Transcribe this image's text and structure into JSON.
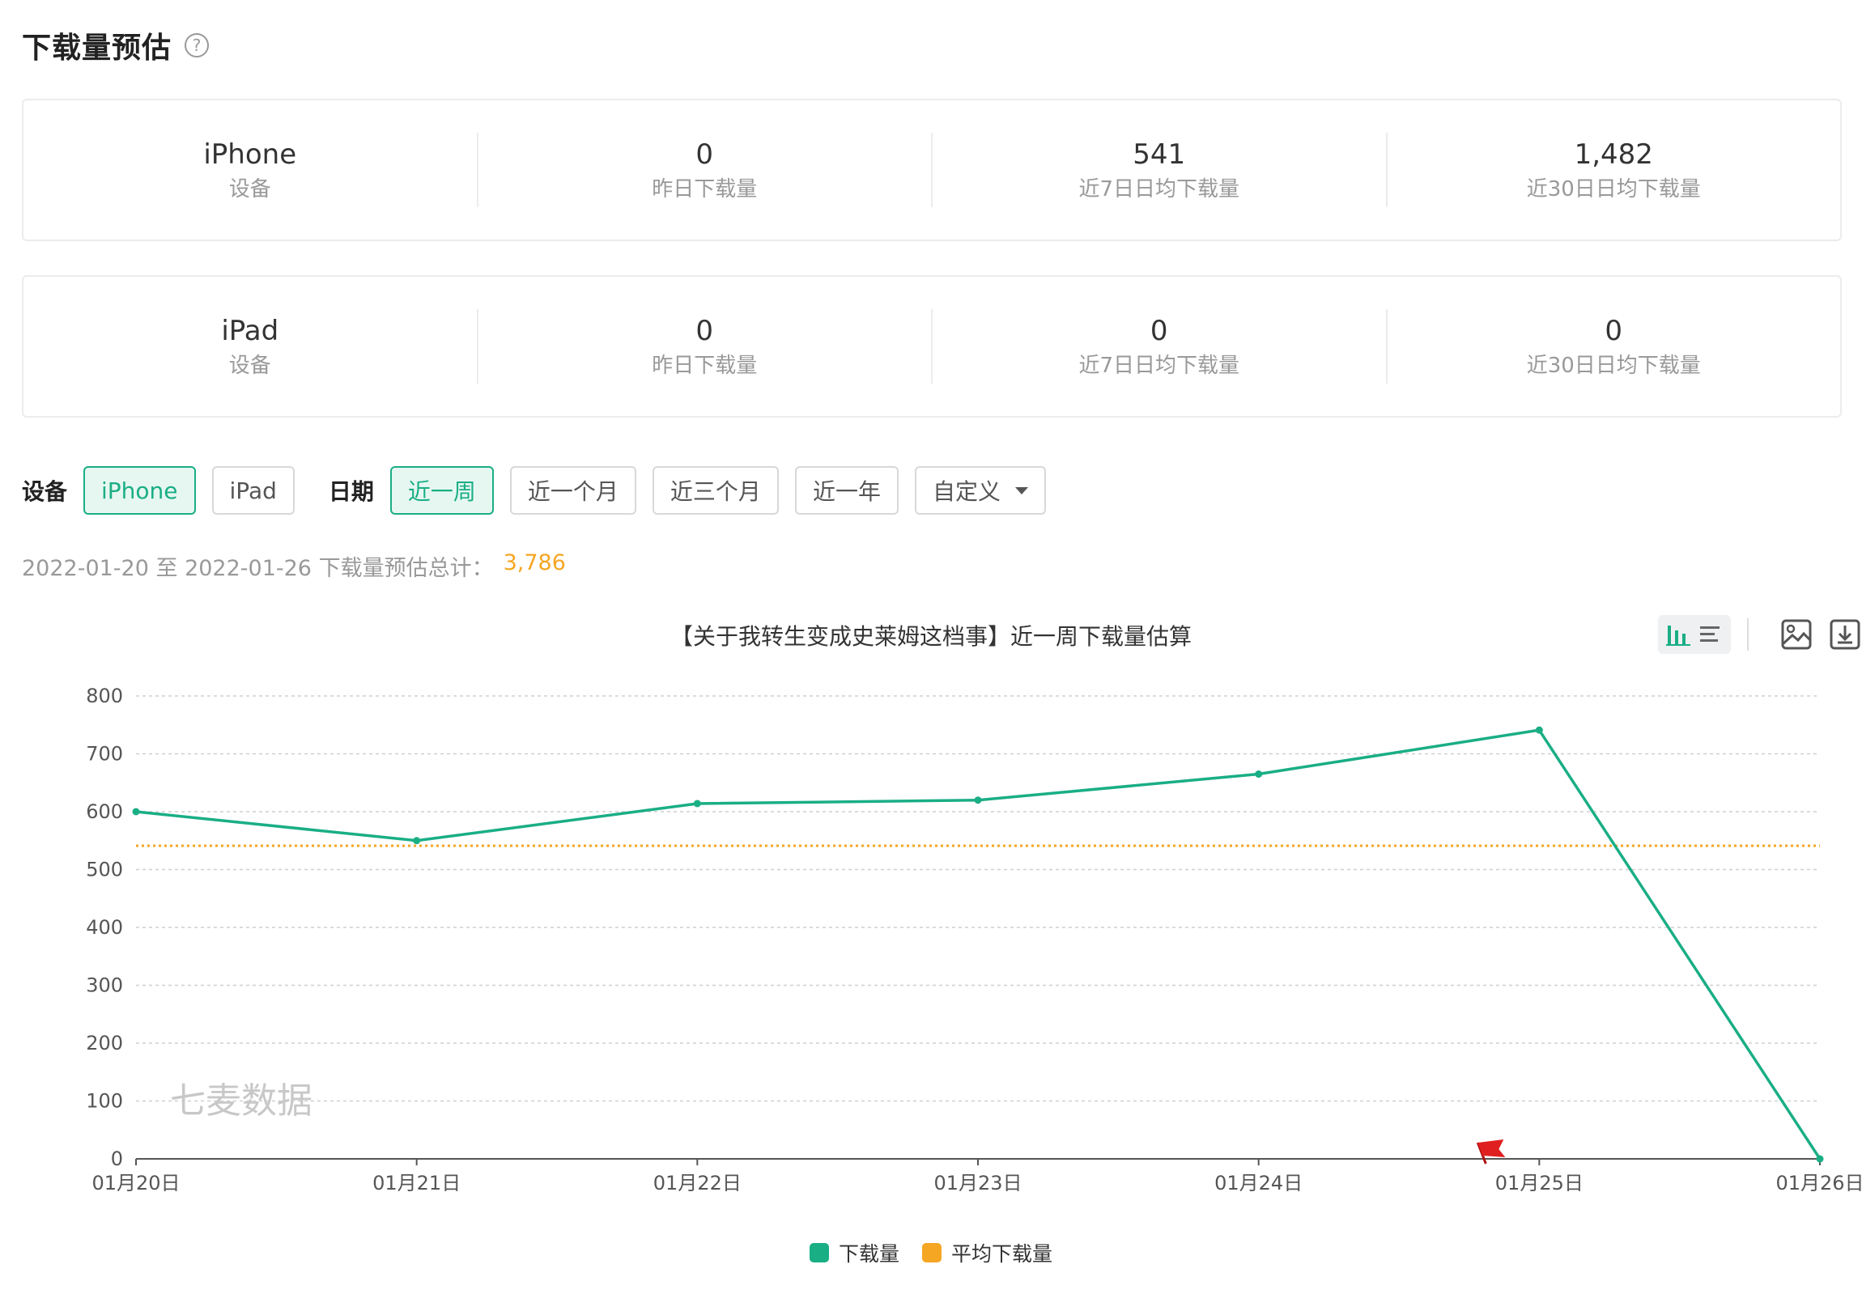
{
  "header": {
    "title": "下载量预估",
    "help_icon": "question-circle-icon"
  },
  "cards": [
    {
      "cells": [
        {
          "value": "iPhone",
          "label": "设备"
        },
        {
          "value": "0",
          "label": "昨日下载量"
        },
        {
          "value": "541",
          "label": "近7日日均下载量"
        },
        {
          "value": "1,482",
          "label": "近30日日均下载量"
        }
      ]
    },
    {
      "cells": [
        {
          "value": "iPad",
          "label": "设备"
        },
        {
          "value": "0",
          "label": "昨日下载量"
        },
        {
          "value": "0",
          "label": "近7日日均下载量"
        },
        {
          "value": "0",
          "label": "近30日日均下载量"
        }
      ]
    }
  ],
  "filters": {
    "device_label": "设备",
    "devices": [
      {
        "label": "iPhone",
        "active": true
      },
      {
        "label": "iPad",
        "active": false
      }
    ],
    "date_label": "日期",
    "ranges": [
      {
        "label": "近一周",
        "active": true
      },
      {
        "label": "近一个月",
        "active": false
      },
      {
        "label": "近三个月",
        "active": false
      },
      {
        "label": "近一年",
        "active": false
      }
    ],
    "custom_label": "自定义"
  },
  "summary": {
    "text": "2022-01-20 至 2022-01-26 下载量预估总计：",
    "total": "3,786"
  },
  "toolbar": {
    "toggle_icons": [
      "bar-chart-icon",
      "list-icon"
    ],
    "buttons": [
      "save-image-icon",
      "download-icon"
    ]
  },
  "colors": {
    "accent": "#1aae85",
    "average": "#f5a623",
    "flag": "#e02020"
  },
  "chart_data": {
    "type": "line",
    "title": "【关于我转生变成史莱姆这档事】近一周下载量估算",
    "categories": [
      "01月20日",
      "01月21日",
      "01月22日",
      "01月23日",
      "01月24日",
      "01月25日",
      "01月26日"
    ],
    "series": [
      {
        "name": "下载量",
        "values": [
          600,
          550,
          614,
          620,
          665,
          741,
          0
        ]
      },
      {
        "name": "平均下载量",
        "values": [
          541,
          541,
          541,
          541,
          541,
          541,
          541
        ]
      }
    ],
    "ylim": [
      0,
      800
    ],
    "yticks": [
      0,
      100,
      200,
      300,
      400,
      500,
      600,
      700,
      800
    ],
    "grid": true,
    "legend_position": "bottom",
    "watermark": "七麦数据",
    "marker": {
      "icon": "red-flag-icon",
      "category": "01月25日"
    }
  }
}
